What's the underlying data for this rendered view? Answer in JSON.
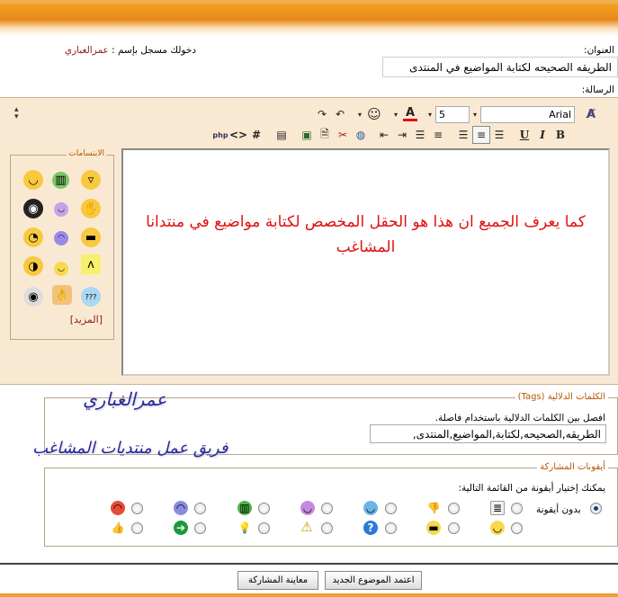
{
  "header": {
    "title_label": "العنوان:",
    "logged_in_label": "دخولك مسجل بإسم :",
    "username": "عمرالغباري",
    "title_value": "الطريقه الصحيحه لكتابة المواضيع في المنتدى",
    "message_label": "الرسالة:"
  },
  "toolbar": {
    "font_name": "Arial",
    "font_size": "5"
  },
  "smilies": {
    "legend": "الابتسامات",
    "more_link": "[المزيد]"
  },
  "editor": {
    "message_text": "كما يعرف الجميع ان هذا هو الحقل المخصص لكتابة مواضيع في منتدانا المشاغب"
  },
  "tags": {
    "legend": "الكلمات الدلالية (Tags)",
    "hint": "افصل بين الكلمات الدلالية باستخدام فاصلة.",
    "value": "الطريقه,الصحيحه,لكتابة,المواضيع,المنتدى,"
  },
  "watermark": {
    "line1": "عمرالغباري",
    "line2": "فريق عمل منتديات المشاغب"
  },
  "post_icons": {
    "legend": "أيقونات المشاركة",
    "hint": "يمكنك إختيار أيقونة من القائمة التالية:",
    "no_icon_label": "بدون أيقونة"
  },
  "buttons": {
    "submit": "اعتمد الموضوع الجديد",
    "preview": "معاينة المشاركة"
  },
  "colors": {
    "accent": "#e8891a",
    "message_text": "#e01010",
    "legend": "#b25800",
    "editor_bg": "#fae9d2"
  }
}
